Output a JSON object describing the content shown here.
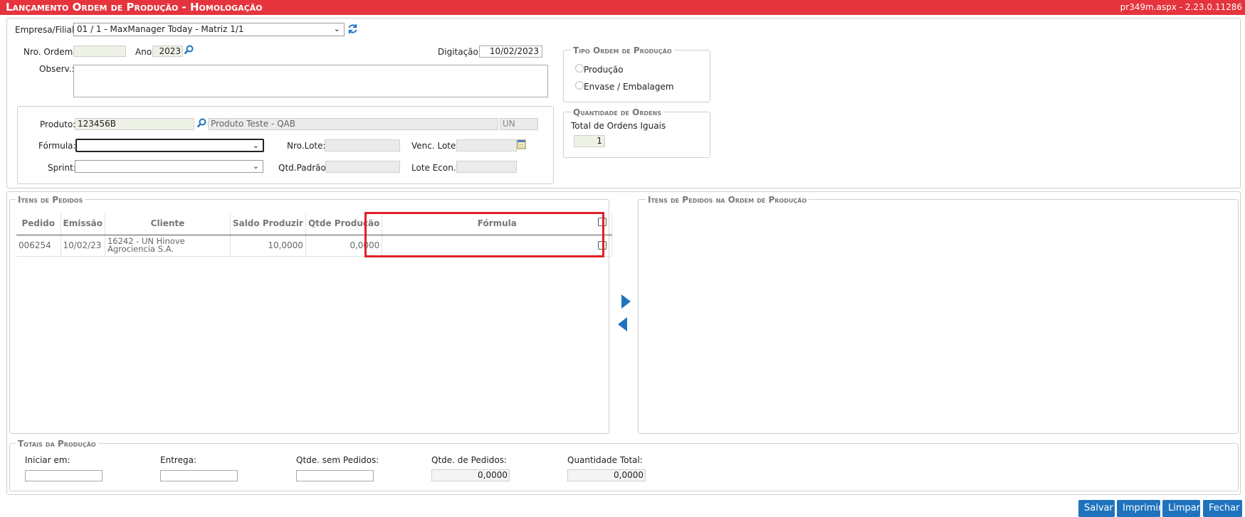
{
  "window": {
    "title": "Lançamento Ordem de Produção  - Homologação",
    "version": "pr349m.aspx - 2.23.0.11286"
  },
  "header": {
    "empresa_label": "Empresa/Filial:",
    "empresa_value": "01 / 1 - MaxManager Today - Matriz 1/1",
    "nro_ordem_label": "Nro. Ordem:",
    "nro_ordem_value": "",
    "ano_label": "Ano:",
    "ano_value": "2023",
    "digitacao_label": "Digitação:",
    "digitacao_value": "10/02/2023",
    "observ_label": "Observ.:",
    "observ_value": ""
  },
  "tipo_ordem": {
    "legend": "Tipo Ordem de Produção",
    "options": [
      "Produção",
      "Envase / Embalagem"
    ]
  },
  "quantidade_ordens": {
    "legend": "Quantidade de Ordens",
    "total_label": "Total de Ordens Iguais",
    "total_value": "1"
  },
  "produto": {
    "produto_label": "Produto:",
    "produto_code": "123456B",
    "produto_desc": "Produto Teste - QAB",
    "unidade": "UN",
    "formula_label": "Fórmula:",
    "formula_value": "",
    "nro_lote_label": "Nro.Lote:",
    "nro_lote_value": "",
    "venc_lote_label": "Venc. Lote:",
    "venc_lote_value": "",
    "sprint_label": "Sprint:",
    "sprint_value": "",
    "qtd_padrao_label": "Qtd.Padrão:",
    "qtd_padrao_value": "",
    "lote_econ_label": "Lote Econ.:",
    "lote_econ_value": ""
  },
  "itens_pedidos": {
    "legend": "Itens de Pedidos",
    "columns": [
      "Pedido",
      "Emissão",
      "Cliente",
      "Saldo Produzir",
      "Qtde Produção",
      "Fórmula"
    ],
    "rows": [
      {
        "pedido": "006254",
        "emissao": "10/02/23",
        "cliente": "16242 - UN Hinove Agrociencia S.A.",
        "saldo": "10,0000",
        "qtde": "0,0000",
        "formula": ""
      }
    ]
  },
  "itens_ordem": {
    "legend": "Itens de Pedidos na Ordem de Produção"
  },
  "totais": {
    "legend": "Totais da Produção",
    "iniciar_label": "Iniciar em:",
    "iniciar_value": "",
    "entrega_label": "Entrega:",
    "entrega_value": "",
    "qtde_sem_label": "Qtde. sem Pedidos:",
    "qtde_sem_value": "",
    "qtde_pedidos_label": "Qtde. de Pedidos:",
    "qtde_pedidos_value": "0,0000",
    "qtde_total_label": "Quantidade Total:",
    "qtde_total_value": "0,0000"
  },
  "buttons": {
    "salvar": "Salvar",
    "imprimir": "Imprimir",
    "limpar": "Limpar",
    "fechar": "Fechar"
  },
  "colors": {
    "title_bar": "#e5343d",
    "button": "#1f73bd",
    "highlight": "#e0202a"
  }
}
